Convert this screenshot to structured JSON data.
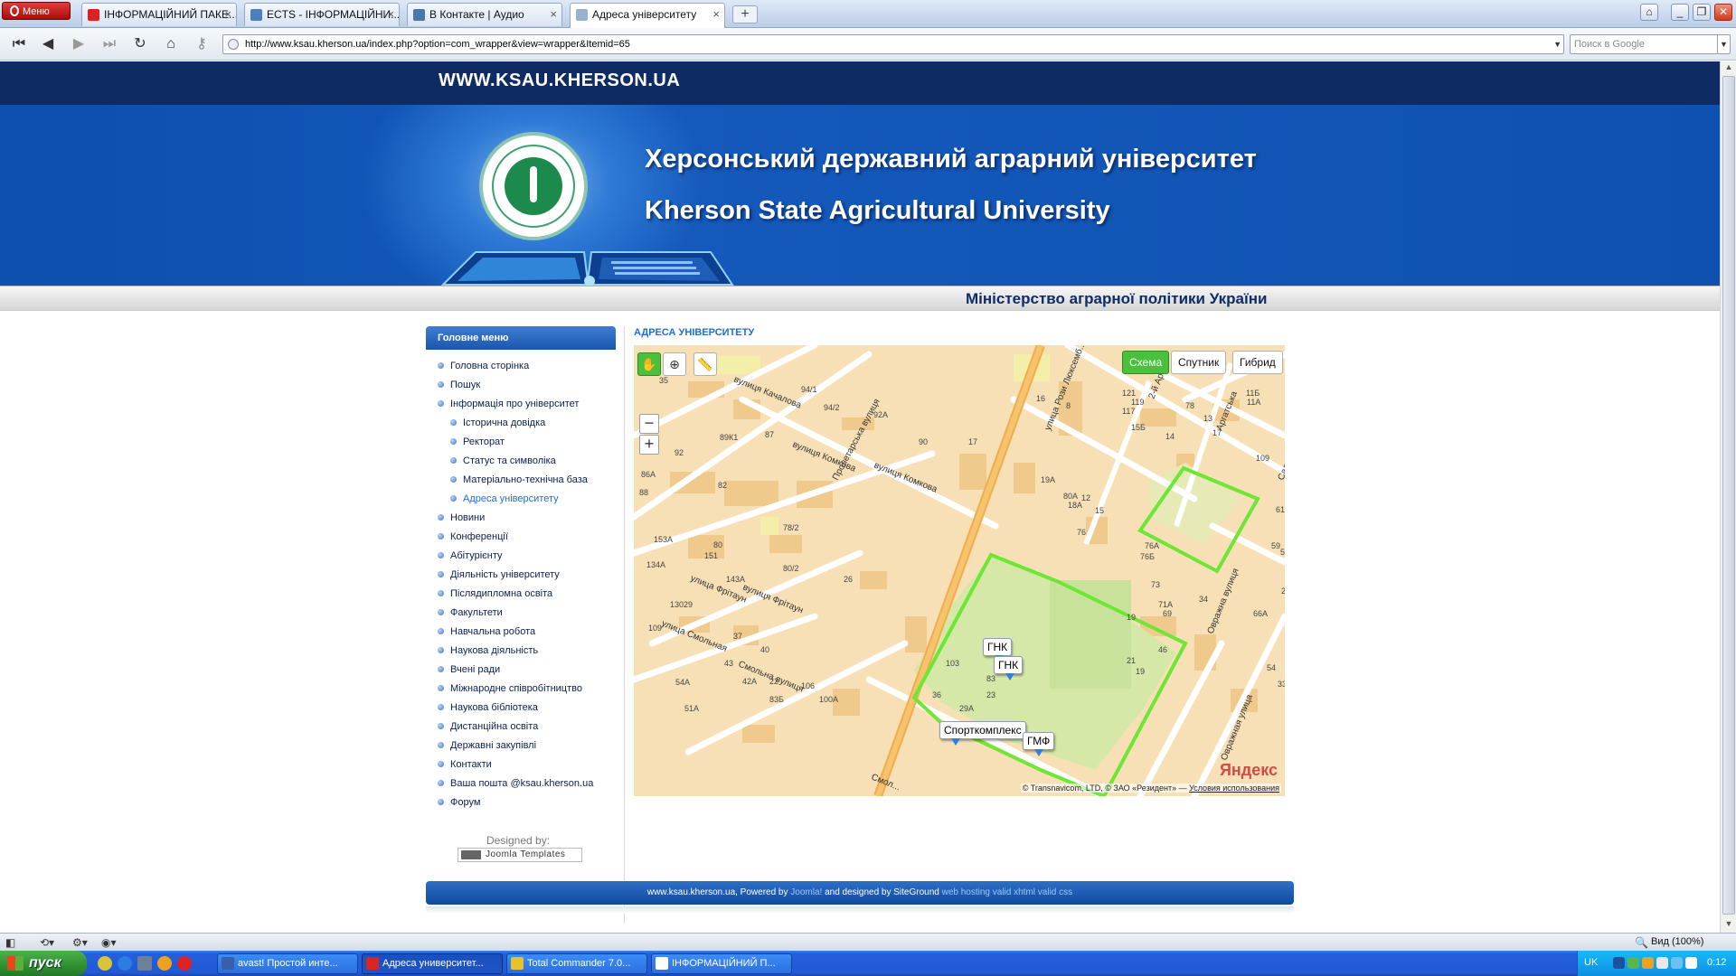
{
  "browser": {
    "menu_label": "Меню",
    "tabs": [
      {
        "label": "ІНФОРМАЦІЙНИЙ ПАКЕ...",
        "favicon": "yandex-icon",
        "color": "#e02020"
      },
      {
        "label": "ECTS - ІНФОРМАЦІЙНИ...",
        "favicon": "page-icon",
        "color": "#4a7fc0"
      },
      {
        "label": "В Контакте | Аудио",
        "favicon": "vk-icon",
        "color": "#4a76a8"
      },
      {
        "label": "Адреса університету",
        "favicon": "page-icon",
        "color": "#9ab0cf"
      }
    ],
    "new_tab_label": "+",
    "close_glyph": "×",
    "address": "http://www.ksau.kherson.ua/index.php?option=com_wrapper&view=wrapper&Itemid=65",
    "search_placeholder": "Поиск в Google",
    "zoom_label": "Вид (100%)"
  },
  "site": {
    "url_header": "WWW.KSAU.KHERSON.UA",
    "title_ua": "Херсонський державний аграрний університет",
    "title_en": "Kherson State Agricultural University",
    "ministry": "Міністерство аграрної політики України"
  },
  "menu": {
    "heading": "Головне меню",
    "items": [
      {
        "label": "Головна сторінка",
        "level": 0
      },
      {
        "label": "Пошук",
        "level": 0
      },
      {
        "label": "Інформація про університет",
        "level": 0
      },
      {
        "label": "Історична довідка",
        "level": 1
      },
      {
        "label": "Ректорат",
        "level": 1
      },
      {
        "label": "Статус та символіка",
        "level": 1
      },
      {
        "label": "Матеріально-технічна база",
        "level": 1
      },
      {
        "label": "Адреса університету",
        "level": 1,
        "active": true
      },
      {
        "label": "Новини",
        "level": 0
      },
      {
        "label": "Конференції",
        "level": 0
      },
      {
        "label": "Абітурієнту",
        "level": 0
      },
      {
        "label": "Діяльність університету",
        "level": 0
      },
      {
        "label": "Післядипломна освіта",
        "level": 0
      },
      {
        "label": "Факультети",
        "level": 0
      },
      {
        "label": "Навчальна робота",
        "level": 0
      },
      {
        "label": "Наукова діяльність",
        "level": 0
      },
      {
        "label": "Вчені ради",
        "level": 0
      },
      {
        "label": "Міжнародне співробітництво",
        "level": 0
      },
      {
        "label": "Наукова бібліотека",
        "level": 0
      },
      {
        "label": "Дистанційна освіта",
        "level": 0
      },
      {
        "label": "Державні закупівлі",
        "level": 0
      },
      {
        "label": "Контакти",
        "level": 0
      },
      {
        "label": "Ваша пошта @ksau.kherson.ua",
        "level": 0
      },
      {
        "label": "Форум",
        "level": 0
      }
    ],
    "designed_by": "Designed by:",
    "joomla_badge": "Joomla Templates"
  },
  "content": {
    "title": "АДРЕСА УНІВЕРСИТЕТУ"
  },
  "map": {
    "types": [
      "Схема",
      "Спутник",
      "Гибрид"
    ],
    "selected_type": "Схема",
    "tools": [
      "hand-icon",
      "magnifier-icon",
      "ruler-icon"
    ],
    "zoom_out": "−",
    "zoom_in": "+",
    "placemarks": [
      "ГНК",
      "ГНК",
      "Спорткомплекс",
      "ГМФ"
    ],
    "streets": [
      "вулиця Качалова",
      "вулиця Комкова",
      "вулиця Комкова",
      "Пролетарська вулиця",
      "улица Фрітаун",
      "вулиця Фрітаун",
      "улица Смольная",
      "Смольна вулиця",
      "улица Рози Люксемб...",
      "Аргатська",
      "Овражна вулиця",
      "Овражная улица",
      "Садова",
      "Смол...",
      "2-й Арт..."
    ],
    "house_numbers": [
      "35",
      "94/1",
      "94/2",
      "92А",
      "87",
      "92",
      "89К1",
      "86А",
      "88",
      "82",
      "90",
      "78/2",
      "80",
      "153А",
      "151",
      "143А",
      "80/2",
      "26",
      "134А",
      "130",
      "109",
      "29",
      "37",
      "40",
      "43",
      "22",
      "54А",
      "51А",
      "42А",
      "83Б",
      "106",
      "100А",
      "17",
      "16",
      "8",
      "121",
      "119",
      "117",
      "78",
      "11Б",
      "11А",
      "17",
      "15Б",
      "14",
      "13",
      "109",
      "19А",
      "80А",
      "18А",
      "12",
      "15",
      "76",
      "76А",
      "76Б",
      "61",
      "59",
      "57",
      "34",
      "69",
      "66А",
      "54",
      "46",
      "21",
      "19",
      "83",
      "103",
      "36",
      "29А",
      "23",
      "73",
      "71А",
      "27",
      "33А",
      "19"
    ],
    "copyright": "© Transnavicom, LTD, © ЗАО «Резидент» —",
    "terms_link": "Условия использования",
    "logo_text": "Яндекс",
    "campus_color": "#6ee636"
  },
  "footer": {
    "prefix": "www.ksau.kherson.ua, Powered by ",
    "joomla": "Joomla!",
    "middle": " and designed by SiteGround ",
    "links": "web hosting valid xhtml valid css"
  },
  "taskbar": {
    "start_label": "пуск",
    "tasks": [
      {
        "label": "avast! Простой инте...",
        "color": "#3b5ea8"
      },
      {
        "label": "Адреса университет...",
        "color": "#d22",
        "active": true
      },
      {
        "label": "Total Commander 7.0...",
        "color": "#e7c22a"
      },
      {
        "label": "ІНФОРМАЦІЙНИЙ П...",
        "color": "#ffffff"
      }
    ],
    "lang": "UK",
    "clock": "0:12"
  }
}
